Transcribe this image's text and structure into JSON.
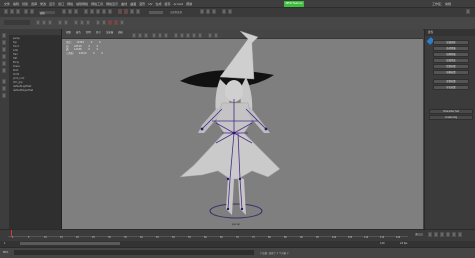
{
  "menubar": {
    "items": [
      "文件",
      "编辑",
      "创建",
      "选择",
      "修改",
      "显示",
      "窗口",
      "网格",
      "编辑网格",
      "网格工具",
      "网格显示",
      "曲线",
      "曲面",
      "变形",
      "UV",
      "生成",
      "缓存",
      "Arnold",
      "帮助"
    ],
    "workspace_value": "工作区： 常规",
    "badge": "NEW Feature"
  },
  "statusline": {
    "mode_value": "建模",
    "selection_hint": "无现用选择"
  },
  "outliner": {
    "items": [
      "persp",
      "top",
      "front",
      "side",
      "Hair",
      "Hat",
      "Body",
      "Dress",
      "Skirt",
      "Cloth",
      "Joint_root",
      "Ctrl_grp",
      "defaultLightSet",
      "defaultObjectSet"
    ]
  },
  "viewport": {
    "menu": [
      "视图",
      "着色",
      "照明",
      "显示",
      "渲染器",
      "面板"
    ],
    "hud": [
      {
        "label": "顶点:",
        "a": "12345",
        "b": "0",
        "c": "0"
      },
      {
        "label": "边:",
        "a": "24510",
        "b": "0",
        "c": "0"
      },
      {
        "label": "面:",
        "a": "12188",
        "b": "0",
        "c": "0"
      },
      {
        "label": "三角形:",
        "a": "24320",
        "b": "0",
        "c": "0"
      }
    ],
    "camera_label": "persp"
  },
  "rightpanel": {
    "tab": "属性",
    "buttons": [
      "加载选择",
      "选择骨骼",
      "镜像骨骼",
      "加载蒙皮",
      "绘制权重",
      "镜像权重",
      "复制权重",
      "导出权重"
    ],
    "section_buttons": [
      "Character Set",
      "Create Rig"
    ]
  },
  "timeline": {
    "ticks": [
      "1",
      "5",
      "10",
      "15",
      "20",
      "25",
      "30",
      "35",
      "40",
      "45",
      "50",
      "55",
      "60",
      "65",
      "70",
      "75",
      "80",
      "85",
      "90",
      "95",
      "100",
      "105",
      "110",
      "115",
      "120"
    ],
    "current_frame": "1"
  },
  "range": {
    "start": "1",
    "end": "120",
    "fps": "24 fps"
  },
  "cmdline": {
    "label": "MEL",
    "message": "// 结果: 选择了 1 个对象 //"
  },
  "colors": {
    "viewport_bg": "#7f7f7f",
    "accent": "#3dbf3d",
    "rig": "#4a2a8a"
  }
}
